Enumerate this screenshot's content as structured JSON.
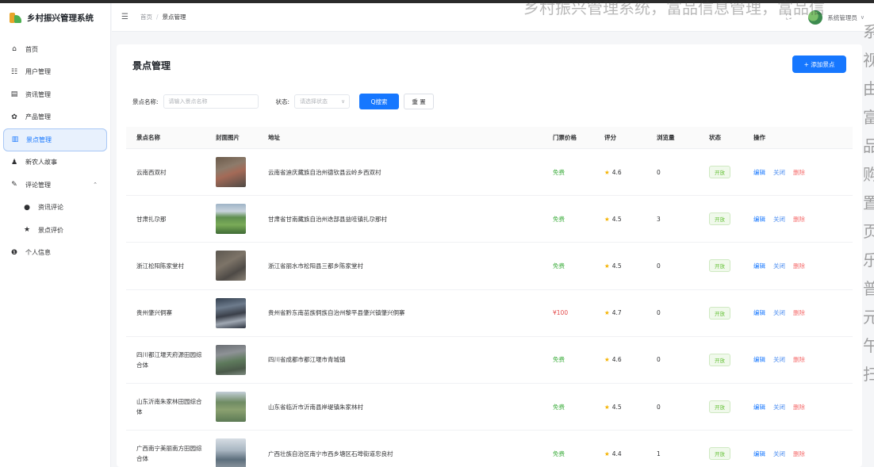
{
  "app": {
    "title": "乡村振兴管理系统"
  },
  "overlay": {
    "top_text": "乡村振兴管理系统，富品信息管理，富品信",
    "side_chars": "系视由富品购置页乐普元午扫"
  },
  "sidebar": {
    "items": [
      {
        "label": "首页",
        "icon": "home-icon",
        "glyph": "⌂"
      },
      {
        "label": "用户管理",
        "icon": "users-icon",
        "glyph": "☷"
      },
      {
        "label": "资讯管理",
        "icon": "news-icon",
        "glyph": "▤"
      },
      {
        "label": "产品管理",
        "icon": "product-icon",
        "glyph": "✿"
      },
      {
        "label": "景点管理",
        "icon": "scenic-icon",
        "glyph": "▥"
      },
      {
        "label": "新农人故事",
        "icon": "person-icon",
        "glyph": "♟"
      },
      {
        "label": "评论管理",
        "icon": "comment-icon",
        "glyph": "✎"
      },
      {
        "label": "资讯评论",
        "icon": "chat-icon",
        "glyph": "●"
      },
      {
        "label": "景点评价",
        "icon": "star-icon",
        "glyph": "★"
      },
      {
        "label": "个人信息",
        "icon": "info-icon",
        "glyph": "❶"
      }
    ],
    "caret": "⌃"
  },
  "header": {
    "fold_icon": "☰",
    "breadcrumb": [
      "首页",
      "景点管理"
    ],
    "separator": "/",
    "fullscreen_icon": "⛶",
    "user_name": "系统管理员",
    "user_caret": "∨"
  },
  "page": {
    "title": "景点管理",
    "add_label": "+ 添加景点"
  },
  "filter": {
    "name_label": "景点名称:",
    "name_placeholder": "请输入景点名称",
    "status_label": "状态:",
    "status_placeholder": "请选择状态",
    "select_caret": "∨",
    "search_label": "Q搜索",
    "reset_label": "重 置"
  },
  "table": {
    "columns": [
      "景点名称",
      "封面图片",
      "地址",
      "门票价格",
      "评分",
      "浏览量",
      "状态",
      "操作"
    ],
    "rows": [
      {
        "name": "云南西双村",
        "address": "云南省迪庆藏族自治州德钦县云岭乡西双村",
        "price": "免费",
        "price_type": "free",
        "score": "4.6",
        "views": "0",
        "status": "开放"
      },
      {
        "name": "甘肃扎尕那",
        "address": "甘肃省甘南藏族自治州迭部县益哇镇扎尕那村",
        "price": "免费",
        "price_type": "free",
        "score": "4.5",
        "views": "3",
        "status": "开放"
      },
      {
        "name": "浙江松阳陈家堂村",
        "address": "浙江省丽水市松阳县三都乡陈家堂村",
        "price": "免费",
        "price_type": "free",
        "score": "4.5",
        "views": "0",
        "status": "开放"
      },
      {
        "name": "贵州肇兴侗寨",
        "address": "贵州省黔东南苗族侗族自治州黎平县肇兴镇肇兴侗寨",
        "price": "¥100",
        "price_type": "paid",
        "score": "4.7",
        "views": "0",
        "status": "开放"
      },
      {
        "name": "四川都江堰天府源田园综合体",
        "address": "四川省成都市都江堰市青城镇",
        "price": "免费",
        "price_type": "free",
        "score": "4.6",
        "views": "0",
        "status": "开放"
      },
      {
        "name": "山东沂南朱家林田园综合体",
        "address": "山东省临沂市沂南县岸堤镇朱家林村",
        "price": "免费",
        "price_type": "free",
        "score": "4.5",
        "views": "0",
        "status": "开放"
      },
      {
        "name": "广西南宁美丽南方田园综合体",
        "address": "广西壮族自治区南宁市西乡塘区石埠街道忠良村",
        "price": "免费",
        "price_type": "free",
        "score": "4.4",
        "views": "1",
        "status": "开放"
      }
    ],
    "op_edit": "编辑",
    "op_close": "关闭",
    "op_delete": "删除",
    "star_glyph": "★"
  }
}
